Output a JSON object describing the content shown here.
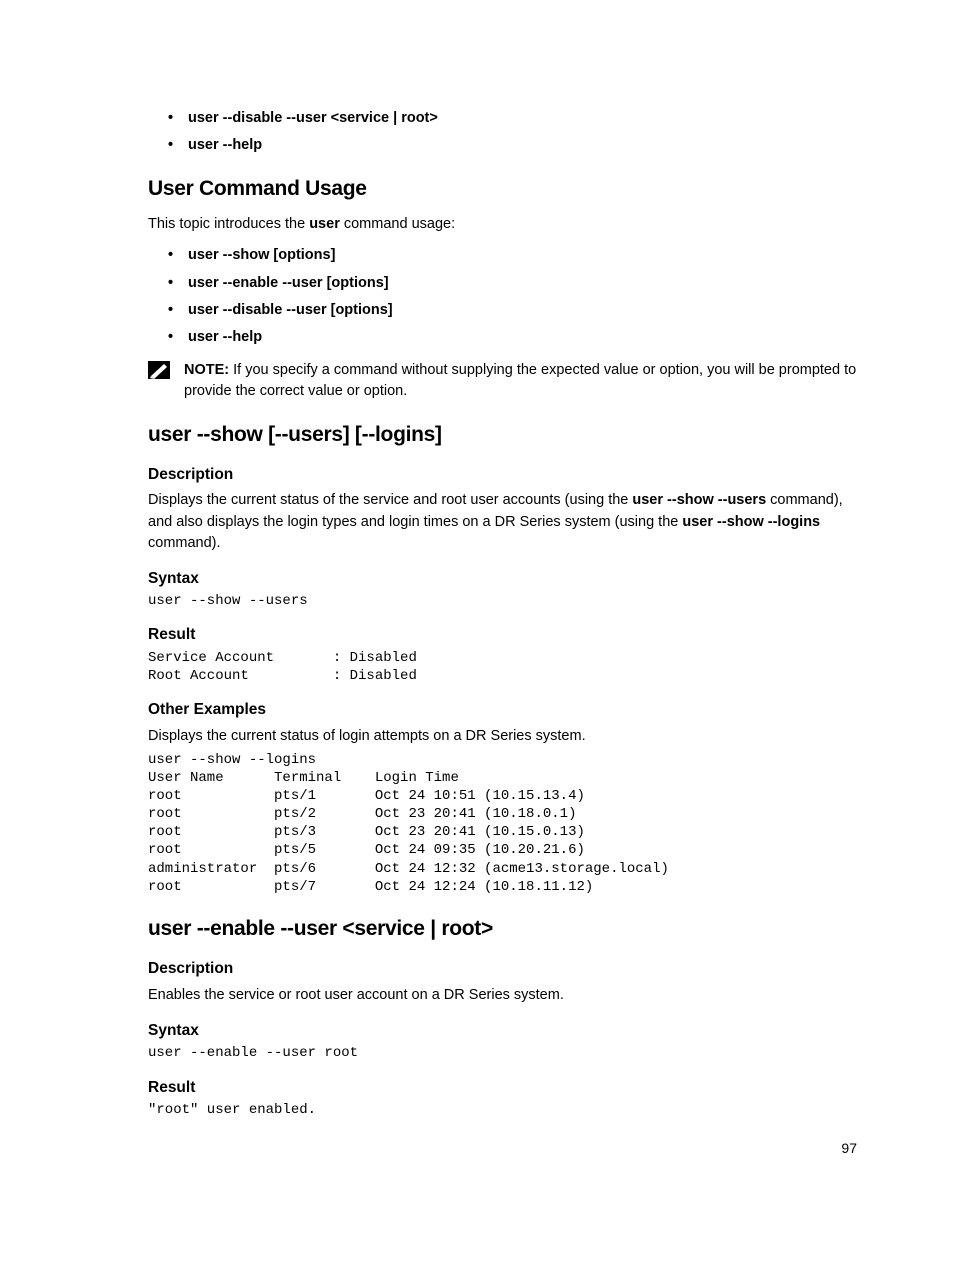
{
  "top_bullets": [
    "user --disable --user <service | root>",
    "user --help"
  ],
  "usage": {
    "heading": "User Command Usage",
    "intro_pre": "This topic introduces the ",
    "intro_cmd": "user",
    "intro_post": " command usage:",
    "bullets": [
      "user --show [options]",
      "user --enable --user [options]",
      "user --disable --user [options]",
      "user --help"
    ],
    "note_label": "NOTE:",
    "note_text": " If you specify a command without supplying the expected value or option, you will be prompted to provide the correct value or option."
  },
  "show": {
    "heading": "user --show [--users] [--logins]",
    "desc_h": "Description",
    "desc_1a": "Displays the current status of the service and root user accounts (using the ",
    "desc_1b": "user --show --users",
    "desc_1c": " command), and also displays the login types and login times on a DR Series system (using the ",
    "desc_1d": "user --show --logins",
    "desc_1e": " command).",
    "syntax_h": "Syntax",
    "syntax": "user --show --users",
    "result_h": "Result",
    "result": "Service Account       : Disabled\nRoot Account          : Disabled",
    "other_h": "Other Examples",
    "other_text": "Displays the current status of login attempts on a DR Series system.",
    "other_block": "user --show --logins\nUser Name      Terminal    Login Time\nroot           pts/1       Oct 24 10:51 (10.15.13.4)\nroot           pts/2       Oct 23 20:41 (10.18.0.1)\nroot           pts/3       Oct 23 20:41 (10.15.0.13)\nroot           pts/5       Oct 24 09:35 (10.20.21.6)\nadministrator  pts/6       Oct 24 12:32 (acme13.storage.local)\nroot           pts/7       Oct 24 12:24 (10.18.11.12)"
  },
  "enable": {
    "heading": "user --enable --user <service | root>",
    "desc_h": "Description",
    "desc_text": "Enables the service or root user account on a DR Series system.",
    "syntax_h": "Syntax",
    "syntax": "user --enable --user root",
    "result_h": "Result",
    "result": "\"root\" user enabled."
  },
  "page_number": "97"
}
